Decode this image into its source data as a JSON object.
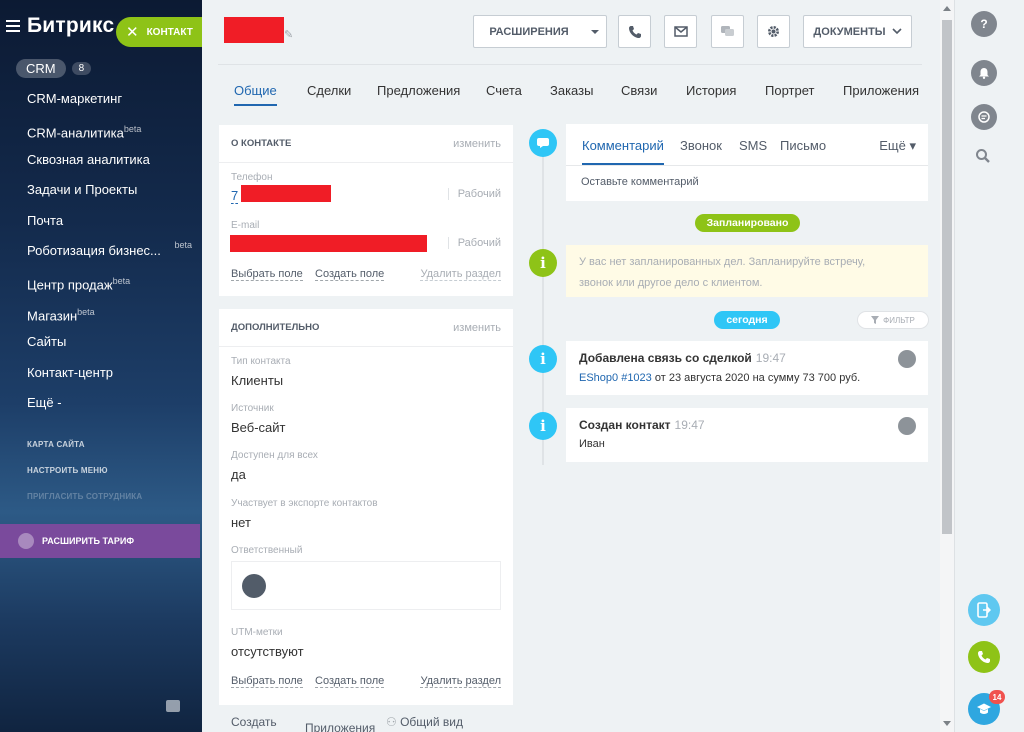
{
  "sidebar": {
    "logo": "Битрикс",
    "contact_button": "КОНТАКТ",
    "crm_label": "CRM",
    "crm_count": "8",
    "items": [
      {
        "label": "CRM-маркетинг",
        "beta": ""
      },
      {
        "label": "CRM-аналитика",
        "beta": "beta"
      },
      {
        "label": "Сквозная аналитика",
        "beta": ""
      },
      {
        "label": "Задачи и Проекты",
        "beta": ""
      },
      {
        "label": "Почта",
        "beta": ""
      },
      {
        "label": "Роботизация бизнес...",
        "beta": "beta"
      },
      {
        "label": "Центр продаж",
        "beta": "beta"
      },
      {
        "label": "Магазин",
        "beta": "beta"
      },
      {
        "label": "Сайты",
        "beta": ""
      },
      {
        "label": "Контакт-центр",
        "beta": ""
      },
      {
        "label": "Ещё -",
        "beta": ""
      }
    ],
    "small_links": [
      "КАРТА САЙТА",
      "НАСТРОИТЬ МЕНЮ",
      "ПРИГЛАСИТЬ СОТРУДНИКА"
    ],
    "upgrade_label": "РАСШИРИТЬ ТАРИФ"
  },
  "header": {
    "extensions_button": "РАСШИРЕНИЯ",
    "documents_button": "ДОКУМЕНТЫ"
  },
  "tabs": [
    "Общие",
    "Сделки",
    "Предложения",
    "Счета",
    "Заказы",
    "Связи",
    "История",
    "Портрет",
    "Приложения"
  ],
  "about": {
    "title": "О КОНТАКТЕ",
    "edit": "изменить",
    "phone_label": "Телефон",
    "phone_prefix": "7",
    "phone_type": "Рабочий",
    "email_label": "E-mail",
    "email_type": "Рабочий",
    "select_field": "Выбрать поле",
    "create_field": "Создать поле",
    "delete_section": "Удалить раздел"
  },
  "extra": {
    "title": "ДОПОЛНИТЕЛЬНО",
    "edit": "изменить",
    "fields": [
      {
        "label": "Тип контакта",
        "value": "Клиенты"
      },
      {
        "label": "Источник",
        "value": "Веб-сайт"
      },
      {
        "label": "Доступен для всех",
        "value": "да"
      },
      {
        "label": "Участвует в экспорте контактов",
        "value": "нет"
      }
    ],
    "responsible_label": "Ответственный",
    "utm_label": "UTM-метки",
    "utm_value": "отсутствуют",
    "select_field": "Выбрать поле",
    "create_field": "Создать поле",
    "delete_section": "Удалить раздел",
    "bottom_create": "Создать",
    "bottom_apps": "Приложения",
    "bottom_view": "Общий вид"
  },
  "timeline": {
    "tabs": [
      "Комментарий",
      "Звонок",
      "SMS",
      "Письмо"
    ],
    "more": "Ещё",
    "comment_placeholder": "Оставьте комментарий",
    "planned_pill": "Запланировано",
    "planned_text_1": "У вас нет запланированных дел. Запланируйте встречу,",
    "planned_text_2": "звонок или другое дело с клиентом.",
    "today_pill": "сегодня",
    "filter_pill": "ФИЛЬТР",
    "events": [
      {
        "title": "Добавлена связь со сделкой",
        "time": "19:47",
        "link": "EShop0 #1023",
        "text": " от 23 августа 2020 на сумму 73 700 руб."
      },
      {
        "title": "Создан контакт",
        "time": "19:47",
        "link": "",
        "text": "Иван"
      }
    ]
  },
  "right_panel": {
    "help_icon": "?",
    "notify_badge": "14"
  },
  "colors": {
    "accent_green": "#8ec317",
    "accent_blue": "#2fc6f6",
    "link_blue": "#2067b0",
    "redaction": "#f01d26"
  }
}
